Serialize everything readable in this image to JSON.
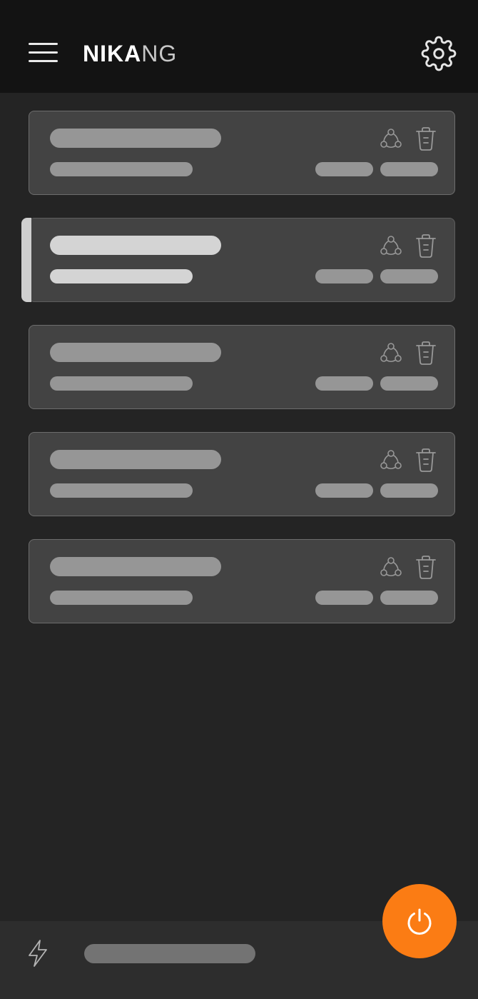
{
  "header": {
    "logo_bold": "NIKA",
    "logo_light": "NG",
    "menu_icon": "hamburger-menu-icon",
    "settings_icon": "gear-icon"
  },
  "list": {
    "item_count": 5,
    "selected_index": 1,
    "item_actions": [
      "share-icon",
      "trash-icon"
    ]
  },
  "footer": {
    "status_icon": "lightning-bolt-icon"
  },
  "fab": {
    "icon": "power-icon",
    "color": "#FB7C14"
  },
  "colors": {
    "background": "#242424",
    "header": "#131313",
    "card": "#434343",
    "card_border": "#6D6D6D",
    "placeholder": "#969696",
    "selected_accent": "#CFCFCF"
  }
}
